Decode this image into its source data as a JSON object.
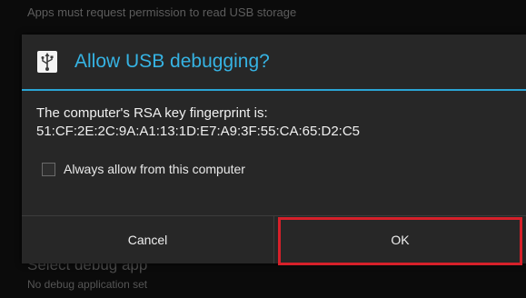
{
  "background": {
    "top_text": "Apps must request permission to read USB storage",
    "select_label": "Select debug app",
    "select_sub": "No debug application set"
  },
  "dialog": {
    "icon": "usb-icon",
    "title": "Allow USB debugging?",
    "message_line1": "The computer's RSA key fingerprint is:",
    "message_line2": "51:CF:2E:2C:9A:A1:13:1D:E7:A9:3F:55:CA:65:D2:C5",
    "checkbox_label": "Always allow from this computer",
    "checkbox_checked": false,
    "cancel_label": "Cancel",
    "ok_label": "OK"
  },
  "colors": {
    "accent": "#36b3e3",
    "divider": "#2aa5d4",
    "dialog_bg": "#272727",
    "highlight": "#d6202a"
  }
}
